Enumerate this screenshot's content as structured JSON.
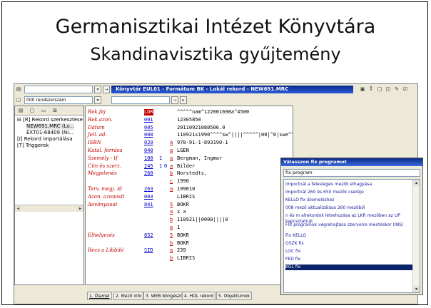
{
  "slide": {
    "title": "Germanisztikai Intézet Könyvtára",
    "subtitle": "Skandinavisztika gyűjtemény"
  },
  "app": {
    "header_text": "Könyvtár EUL01 - Formátum BK - Lokál rekord - NEW691.MRC",
    "view_select": "000 rendszerszám",
    "tree": [
      "[R] Rekord szerkesztése",
      "NEW691.MRC (Lo...",
      "EXT01-68409 (Ni...",
      "[I] Rekord importálása",
      "[T] Triggerek"
    ],
    "records": [
      {
        "label": "Rek.fej",
        "tag": "LDR",
        "ind1": "",
        "ind2": "",
        "sub": "",
        "value": "^^^^^nam^122001698a^4500"
      },
      {
        "label": "Rek.azon.",
        "tag": "001",
        "ind1": "",
        "ind2": "",
        "sub": "",
        "value": "12305850"
      },
      {
        "label": "Dátum",
        "tag": "005",
        "ind1": "",
        "ind2": "",
        "sub": "",
        "value": "20110921080506.0"
      },
      {
        "label": "Jell. ad.",
        "tag": "008",
        "ind1": "",
        "ind2": "",
        "sub": "",
        "value": "110921s1990^^^^sw^||||^^^^^|00|^0|swe^^"
      },
      {
        "label": "ISBN",
        "tag": "020",
        "ind1": "",
        "ind2": "",
        "sub": "a",
        "value": "978-91-1-893190-1"
      },
      {
        "label": "Katal. forrása",
        "tag": "040",
        "ind1": "",
        "ind2": "",
        "sub": "a",
        "value": "LGEN"
      },
      {
        "label": "Személy - tf",
        "tag": "100",
        "ind1": "1",
        "ind2": "",
        "sub": "a",
        "value": "Bergman, Ingmar"
      },
      {
        "label": "Cím és szerz.",
        "tag": "245",
        "ind1": "1",
        "ind2": "0",
        "sub": "a",
        "value": "Bilder"
      },
      {
        "label": "Megjelenés",
        "tag": "260",
        "ind1": "",
        "ind2": "",
        "sub": "b",
        "value": "Norstedts,"
      },
      {
        "label": "",
        "tag": "",
        "ind1": "",
        "ind2": "",
        "sub": "c",
        "value": "1990"
      },
      {
        "label": "Terv. megj. id",
        "tag": "263",
        "ind1": "",
        "ind2": "",
        "sub": "a",
        "value": "199010"
      },
      {
        "label": "Azon. azonosít",
        "tag": "003",
        "ind1": "",
        "ind2": "",
        "sub": "",
        "value": "LIBRIS"
      },
      {
        "label": "Aoványauat",
        "tag": "841",
        "ind1": "",
        "ind2": "",
        "sub": "5",
        "value": "BOKR"
      },
      {
        "label": "",
        "tag": "",
        "ind1": "",
        "ind2": "",
        "sub": "a",
        "value": "x a"
      },
      {
        "label": "",
        "tag": "",
        "ind1": "",
        "ind2": "",
        "sub": "b",
        "value": "110921||0000||||0"
      },
      {
        "label": "",
        "tag": "",
        "ind1": "",
        "ind2": "",
        "sub": "e",
        "value": "1"
      },
      {
        "label": "Elhelyezés",
        "tag": "852",
        "ind1": "",
        "ind2": "",
        "sub": "5",
        "value": "BOKR"
      },
      {
        "label": "",
        "tag": "",
        "ind1": "",
        "ind2": "",
        "sub": "b",
        "value": "BOKR"
      },
      {
        "label": "Recs a Libbibl",
        "tag": "SID",
        "ind1": "",
        "ind2": "",
        "sub": "a",
        "value": "239"
      },
      {
        "label": "",
        "tag": "",
        "ind1": "",
        "ind2": "",
        "sub": "b",
        "value": "LIBRIS"
      }
    ],
    "tabs": [
      "1. Űlamel",
      "2. Mező info",
      "3. WEB böngésző",
      "4. HOL rekord",
      "5. Objektumok"
    ]
  },
  "dialog": {
    "title": "Válasszon fix programot",
    "input_value": "fix program",
    "items": [
      "Importnál a felesleges mezők elhagyása",
      "Importnál 260 és 650 mezők cseréje",
      "KELLO fix átemeléshez",
      "008 mező aktualizálása 260 mezőből",
      "n és m alrekordok létrehozása az LKR mezőben az UP kapcsolatnál",
      "FIX programok végrehajtása szerverre mentéskor (INS)",
      "Fix KELLO",
      "OSZK fix",
      "LOC fix",
      "FED fix",
      "KGL fix"
    ],
    "selected_index": 10
  },
  "colors": {
    "title_bar": "#0a246a",
    "field_label": "#c00000",
    "field_tag": "#0000cc"
  }
}
